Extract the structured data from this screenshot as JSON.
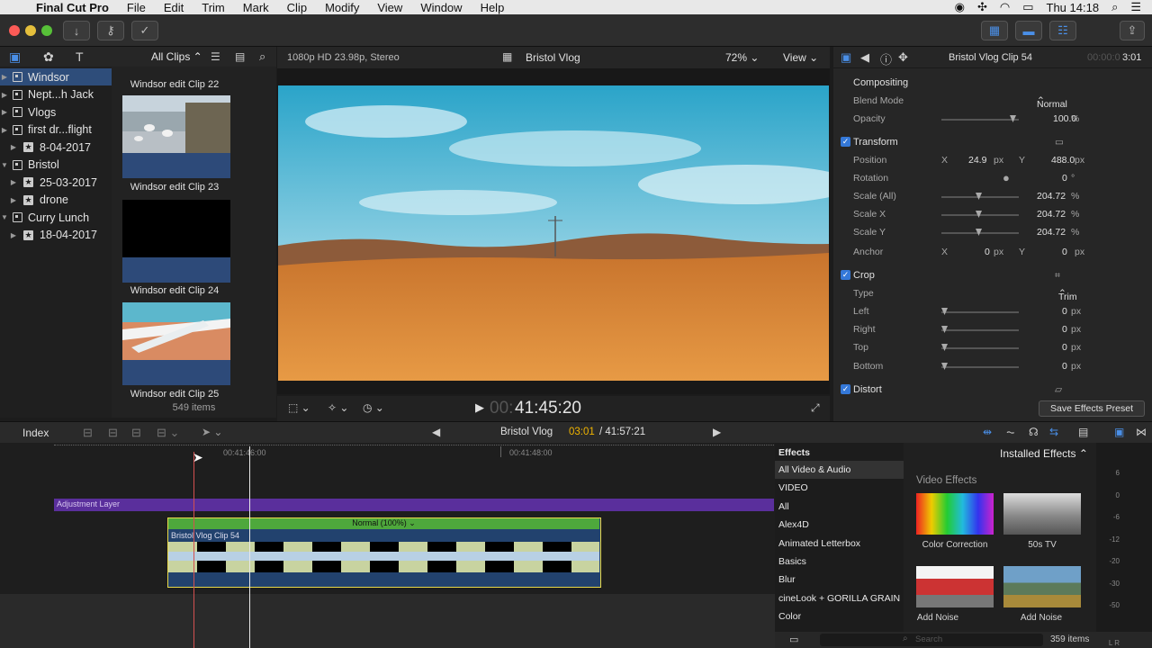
{
  "menubar": {
    "app": "Final Cut Pro",
    "items": [
      "File",
      "Edit",
      "Trim",
      "Mark",
      "Clip",
      "Modify",
      "View",
      "Window",
      "Help"
    ],
    "clock": "Thu 14:18"
  },
  "library": {
    "rows": [
      {
        "label": "Windsor",
        "type": "event",
        "level": 0,
        "selected": true
      },
      {
        "label": "Nept...h Jack",
        "type": "event",
        "level": 0
      },
      {
        "label": "Vlogs",
        "type": "event",
        "level": 0
      },
      {
        "label": "first dr...flight",
        "type": "event",
        "level": 0
      },
      {
        "label": "8-04-2017",
        "type": "keyword",
        "level": 1
      },
      {
        "label": "Bristol",
        "type": "event",
        "level": 0,
        "expanded": true
      },
      {
        "label": "25-03-2017",
        "type": "keyword",
        "level": 1
      },
      {
        "label": "drone",
        "type": "keyword",
        "level": 1
      },
      {
        "label": "Curry Lunch",
        "type": "event",
        "level": 0,
        "expanded": true
      },
      {
        "label": "18-04-2017",
        "type": "keyword",
        "level": 1
      }
    ]
  },
  "browser": {
    "filter": "All Clips",
    "clips": [
      "Windsor edit Clip 22",
      "Windsor edit Clip 23",
      "Windsor edit Clip 24",
      "Windsor edit Clip 25"
    ],
    "count": "549 items"
  },
  "viewer": {
    "format": "1080p HD 23.98p, Stereo",
    "title": "Bristol Vlog",
    "zoom": "72%",
    "view": "View",
    "timecode_dim": "00:",
    "timecode": "41:45:20"
  },
  "inspector": {
    "clip": "Bristol Vlog Clip 54",
    "time_dim": "00:00:0",
    "time": "3:01",
    "compositing": "Compositing",
    "blend_label": "Blend Mode",
    "blend": "Normal",
    "opacity_label": "Opacity",
    "opacity": "100.0",
    "pct": "%",
    "transform": "Transform",
    "position": "Position",
    "pos_x": "24.9",
    "pos_y": "488.0",
    "px": "px",
    "x": "X",
    "y": "Y",
    "rotation": "Rotation",
    "rot": "0",
    "deg": "°",
    "scale_all": "Scale (All)",
    "scale_all_v": "204.72",
    "scale_x": "Scale X",
    "scale_x_v": "204.72",
    "scale_y": "Scale Y",
    "scale_y_v": "204.72",
    "anchor": "Anchor",
    "anchor_x": "0",
    "anchor_y": "0",
    "crop": "Crop",
    "type_label": "Type",
    "type": "Trim",
    "left": "Left",
    "right": "Right",
    "top": "Top",
    "bottom": "Bottom",
    "zero": "0",
    "distort": "Distort",
    "save_preset": "Save Effects Preset"
  },
  "timeline": {
    "index": "Index",
    "project": "Bristol Vlog",
    "pos": "03:01",
    "duration": "/ 41:57:21",
    "ruler1": "00:41:46:00",
    "ruler2": "00:41:48:00",
    "adjustment": "Adjustment Layer",
    "clip_mode": "Normal (100%)",
    "clip_name": "Bristol Vlog Clip 54"
  },
  "effects": {
    "header": "Effects",
    "installed": "Installed Effects",
    "section": "Video Effects",
    "categories": [
      "All Video & Audio",
      "VIDEO",
      "All",
      "Alex4D",
      "Animated Letterbox",
      "Basics",
      "Blur",
      "cineLook + GORILLA GRAIN",
      "Color"
    ],
    "tiles": [
      "Color Correction",
      "50s TV",
      "Add Noise",
      "Add Noise"
    ],
    "search": "Search",
    "count": "359 items",
    "meter": [
      "6",
      "0",
      "-6",
      "-12",
      "-20",
      "-30",
      "-50"
    ],
    "lr": "L R"
  }
}
